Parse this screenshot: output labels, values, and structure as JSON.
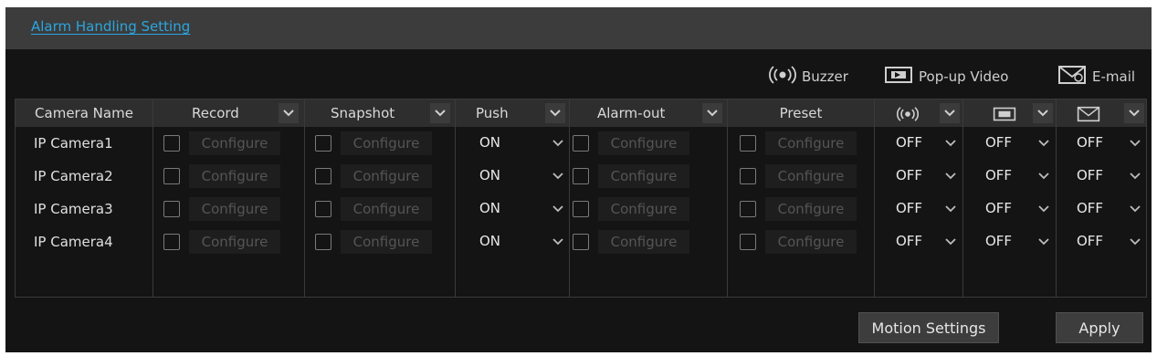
{
  "dialog": {
    "title": "Alarm Handling Setting"
  },
  "legend": {
    "buzzer": "Buzzer",
    "popup": "Pop-up Video",
    "email": "E-mail"
  },
  "columns": {
    "camera_name": "Camera Name",
    "record": "Record",
    "snapshot": "Snapshot",
    "push": "Push",
    "alarm_out": "Alarm-out",
    "preset": "Preset"
  },
  "rows": [
    {
      "camera": "IP Camera1",
      "record": "Configure",
      "snapshot": "Configure",
      "push": "ON",
      "alarm_out": "Configure",
      "preset": "Configure",
      "buzzer": "OFF",
      "popup": "OFF",
      "email": "OFF"
    },
    {
      "camera": "IP Camera2",
      "record": "Configure",
      "snapshot": "Configure",
      "push": "ON",
      "alarm_out": "Configure",
      "preset": "Configure",
      "buzzer": "OFF",
      "popup": "OFF",
      "email": "OFF"
    },
    {
      "camera": "IP Camera3",
      "record": "Configure",
      "snapshot": "Configure",
      "push": "ON",
      "alarm_out": "Configure",
      "preset": "Configure",
      "buzzer": "OFF",
      "popup": "OFF",
      "email": "OFF"
    },
    {
      "camera": "IP Camera4",
      "record": "Configure",
      "snapshot": "Configure",
      "push": "ON",
      "alarm_out": "Configure",
      "preset": "Configure",
      "buzzer": "OFF",
      "popup": "OFF",
      "email": "OFF"
    }
  ],
  "buttons": {
    "motion": "Motion Settings",
    "apply": "Apply"
  },
  "colors": {
    "accent": "#2aa6e0",
    "panel": "#141414",
    "titlebar": "#3c3c3c"
  }
}
